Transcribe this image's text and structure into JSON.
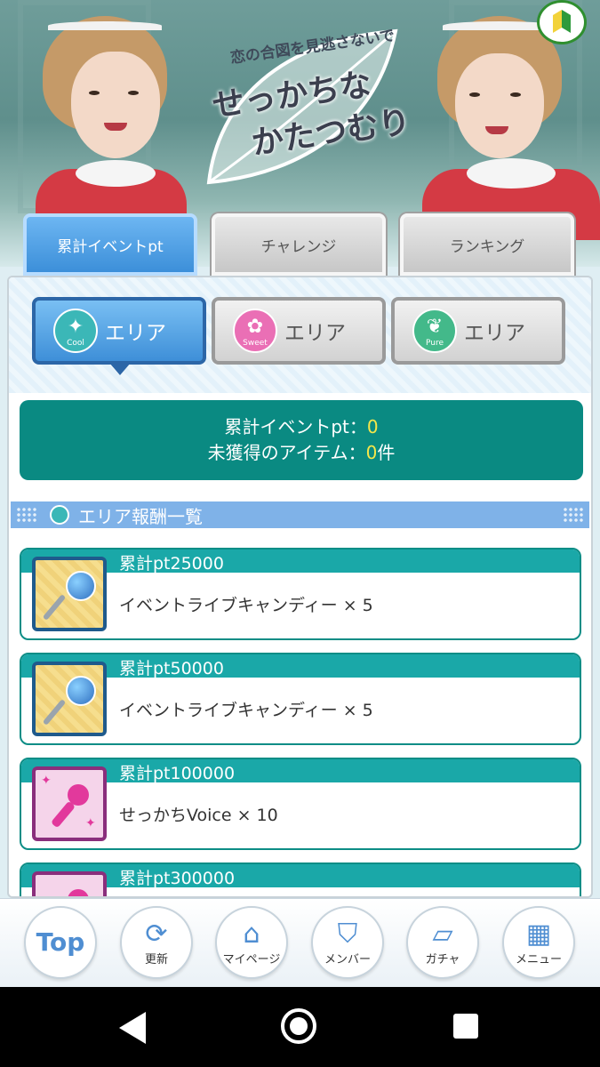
{
  "banner": {
    "logo_subtitle": "恋の合図を見逃さないで",
    "logo_title_line1": "せっかちな",
    "logo_title_line2": "かたつむり"
  },
  "tabs": [
    {
      "label": "累計イベントpt",
      "active": true
    },
    {
      "label": "チャレンジ",
      "active": false
    },
    {
      "label": "ランキング",
      "active": false
    }
  ],
  "areas": [
    {
      "badge": "Cool",
      "label": "エリア",
      "active": true
    },
    {
      "badge": "Sweet",
      "label": "エリア",
      "active": false
    },
    {
      "badge": "Pure",
      "label": "エリア",
      "active": false
    }
  ],
  "summary": {
    "line1_label": "累計イベントpt：",
    "line1_value": "0",
    "line2_label": "未獲得のアイテム：",
    "line2_value": "0",
    "line2_unit": "件"
  },
  "section": {
    "title": "エリア報酬一覧"
  },
  "rewards": [
    {
      "title": "累計pt25000",
      "item": "イベントライブキャンディー × 5",
      "icon": "candy-icon"
    },
    {
      "title": "累計pt50000",
      "item": "イベントライブキャンディー × 5",
      "icon": "candy-icon"
    },
    {
      "title": "累計pt100000",
      "item": "せっかちVoice × 10",
      "icon": "microphone-icon"
    },
    {
      "title": "累計pt300000",
      "item": "",
      "icon": "microphone-icon"
    }
  ],
  "nav": [
    {
      "label": "Top",
      "icon": "top-icon"
    },
    {
      "label": "更新",
      "icon": "refresh-icon"
    },
    {
      "label": "マイページ",
      "icon": "home-icon"
    },
    {
      "label": "メンバー",
      "icon": "member-icon"
    },
    {
      "label": "ガチャ",
      "icon": "gacha-icon"
    },
    {
      "label": "メニュー",
      "icon": "menu-grid-icon"
    }
  ],
  "colors": {
    "accent_blue": "#3c8fd9",
    "teal": "#0a8a82",
    "reward_header": "#1aa8a8",
    "highlight_value": "#f5e64a"
  }
}
